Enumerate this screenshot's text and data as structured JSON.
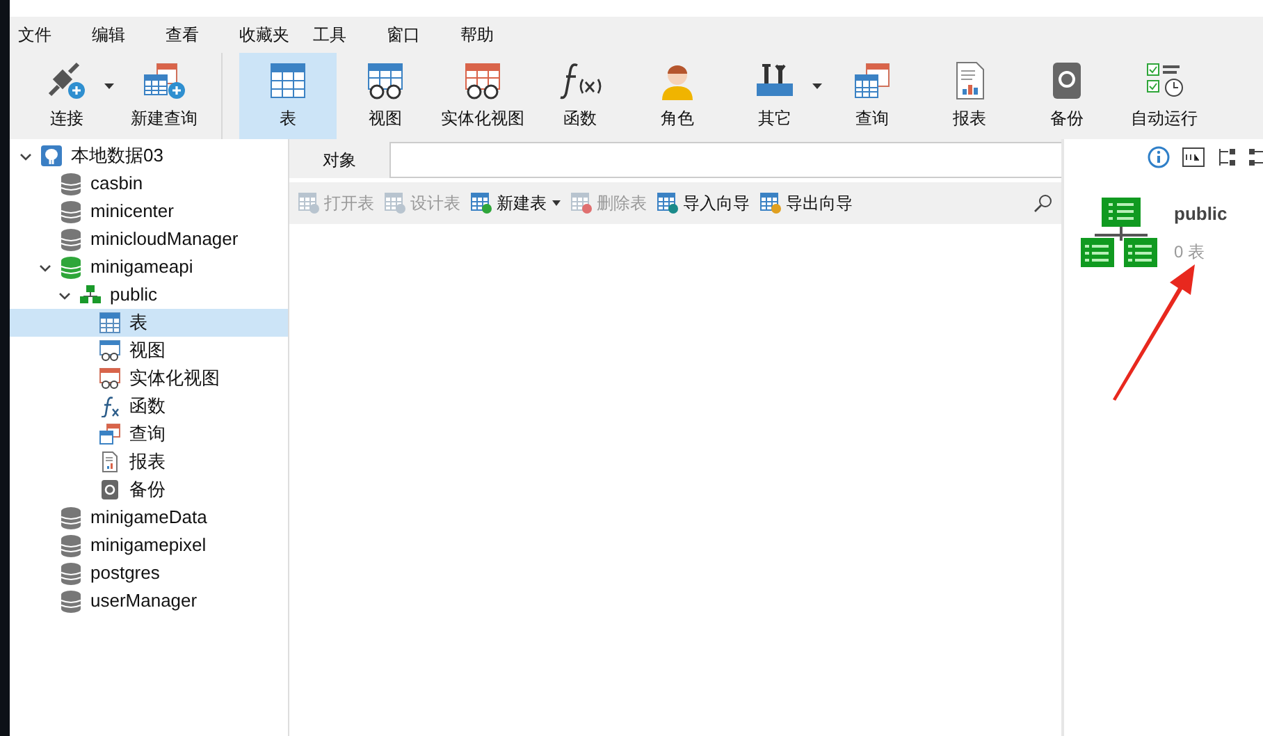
{
  "menu": [
    "文件",
    "编辑",
    "查看",
    "收藏夹",
    "工具",
    "窗口",
    "帮助"
  ],
  "toolbar": [
    {
      "kind": "connect",
      "label": "连接",
      "selected": false,
      "dropdown": true
    },
    {
      "kind": "new-query",
      "label": "新建查询",
      "selected": false,
      "dropdown": false
    },
    {
      "kind": "table",
      "label": "表",
      "selected": true,
      "dropdown": false
    },
    {
      "kind": "view",
      "label": "视图",
      "selected": false,
      "dropdown": false
    },
    {
      "kind": "matview",
      "label": "实体化视图",
      "selected": false,
      "dropdown": false
    },
    {
      "kind": "function",
      "label": "函数",
      "selected": false,
      "dropdown": false
    },
    {
      "kind": "role",
      "label": "角色",
      "selected": false,
      "dropdown": false
    },
    {
      "kind": "other",
      "label": "其它",
      "selected": false,
      "dropdown": true
    },
    {
      "kind": "query",
      "label": "查询",
      "selected": false,
      "dropdown": false
    },
    {
      "kind": "report",
      "label": "报表",
      "selected": false,
      "dropdown": false
    },
    {
      "kind": "backup",
      "label": "备份",
      "selected": false,
      "dropdown": false
    },
    {
      "kind": "schedule",
      "label": "自动运行",
      "selected": false,
      "dropdown": false
    }
  ],
  "tree": [
    {
      "kind": "connection",
      "label": "本地数据03",
      "expanded": true,
      "selected": false,
      "children": [
        {
          "kind": "database",
          "label": "casbin",
          "open": false,
          "selected": false
        },
        {
          "kind": "database",
          "label": "minicenter",
          "open": false,
          "selected": false
        },
        {
          "kind": "database",
          "label": "minicloudManager",
          "open": false,
          "selected": false
        },
        {
          "kind": "database",
          "label": "minigameapi",
          "open": true,
          "expanded": true,
          "selected": false,
          "children": [
            {
              "kind": "schema",
              "label": "public",
              "expanded": true,
              "selected": false,
              "children": [
                {
                  "kind": "table",
                  "label": "表",
                  "selected": true
                },
                {
                  "kind": "view",
                  "label": "视图",
                  "selected": false
                },
                {
                  "kind": "matview",
                  "label": "实体化视图",
                  "selected": false
                },
                {
                  "kind": "function",
                  "label": "函数",
                  "selected": false
                },
                {
                  "kind": "query",
                  "label": "查询",
                  "selected": false
                },
                {
                  "kind": "report",
                  "label": "报表",
                  "selected": false
                },
                {
                  "kind": "backup",
                  "label": "备份",
                  "selected": false
                }
              ]
            }
          ]
        },
        {
          "kind": "database",
          "label": "minigameData",
          "open": false,
          "selected": false
        },
        {
          "kind": "database",
          "label": "minigamepixel",
          "open": false,
          "selected": false
        },
        {
          "kind": "database",
          "label": "postgres",
          "open": false,
          "selected": false
        },
        {
          "kind": "database",
          "label": "userManager",
          "open": false,
          "selected": false
        }
      ]
    }
  ],
  "tabs": [
    {
      "label": "对象",
      "selected": true
    }
  ],
  "object_toolbar": [
    {
      "kind": "open",
      "label": "打开表",
      "disabled": true,
      "dropdown": false
    },
    {
      "kind": "design",
      "label": "设计表",
      "disabled": true,
      "dropdown": false
    },
    {
      "kind": "new",
      "label": "新建表",
      "disabled": false,
      "dropdown": true
    },
    {
      "kind": "delete",
      "label": "删除表",
      "disabled": true,
      "dropdown": false
    },
    {
      "kind": "import",
      "label": "导入向导",
      "disabled": false,
      "dropdown": false
    },
    {
      "kind": "export",
      "label": "导出向导",
      "disabled": false,
      "dropdown": false
    }
  ],
  "info_panel": {
    "name": "public",
    "count": "0 表"
  }
}
